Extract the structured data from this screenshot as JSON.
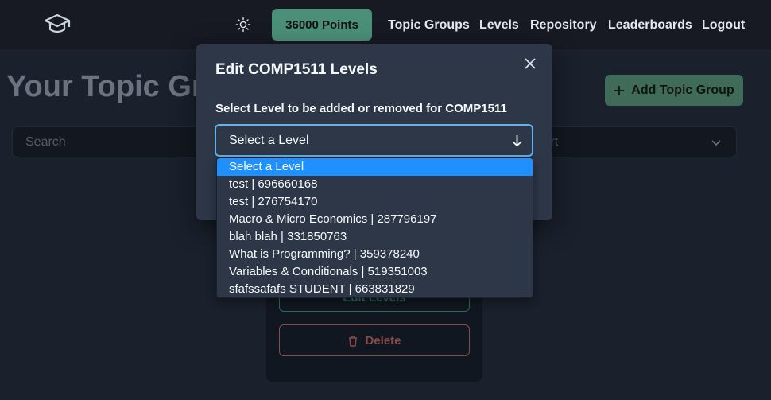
{
  "navbar": {
    "logo_icon": "graduation-cap-icon",
    "theme_icon": "sun-icon",
    "points": "36000 Points",
    "links": [
      "Topic Groups",
      "Levels",
      "Repository",
      "Leaderboards",
      "Logout"
    ]
  },
  "page": {
    "title": "Your Topic Groups",
    "add_button": "Add Topic Group",
    "search_placeholder": "Search",
    "sort_label": "Sort",
    "card": {
      "edit_button": "Edit Levels",
      "delete_button": "Delete"
    }
  },
  "modal": {
    "title": "Edit COMP1511 Levels",
    "label": "Select Level to be added or removed for COMP1511",
    "select_value": "Select a Level",
    "options": [
      "Select a Level",
      "test | 696660168",
      "test | 276754170",
      "Macro & Micro Economics | 287796197",
      "blah blah | 331850763",
      "What is Programming? | 359378240",
      "Variables & Conditionals | 519351003",
      "sfafssafafs STUDENT | 663831829"
    ]
  },
  "colors": {
    "background": "#1a202c",
    "modal_bg": "#2d3748",
    "accent_green": "#4b8f79",
    "focus_blue": "#63b3ed",
    "option_highlight": "#1e90ff",
    "delete_red": "#8a4b47"
  }
}
